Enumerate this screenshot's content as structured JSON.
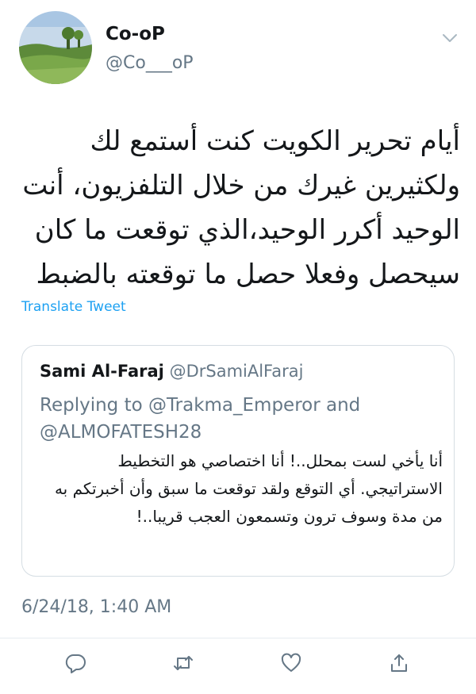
{
  "tweet": {
    "display_name": "Co-oP",
    "handle": "@Co___oP",
    "text": "أيام تحرير الكويت كنت أستمع لك ولكثيرين غيرك من خلال التلفزيون، أنت الوحيد أكرر الوحيد،الذي توقعت ما كان سيحصل وفعلا حصل ما توقعته بالضبط",
    "translate_label": "Translate Tweet",
    "timestamp": "6/24/18, 1:40 AM"
  },
  "quoted": {
    "name": "Sami Al-Faraj",
    "handle": "@DrSamiAlFaraj",
    "replying": "Replying to @Trakma_Emperor and @ALMOFATESH28",
    "text": "أنا يأخي لست بمحلل..! أنا اختصاصي هو التخطيط الاستراتيجي. أي التوقع ولقد توقعت ما سبق وأن أخبرتكم به من مدة وسوف ترون وتسمعون العجب قريبا..!"
  },
  "actions": {
    "icons": [
      "reply-icon",
      "retweet-icon",
      "like-icon",
      "share-icon"
    ]
  },
  "colors": {
    "link": "#1da1f2",
    "muted": "#657786",
    "text": "#14171a",
    "border": "#d5dde3"
  }
}
